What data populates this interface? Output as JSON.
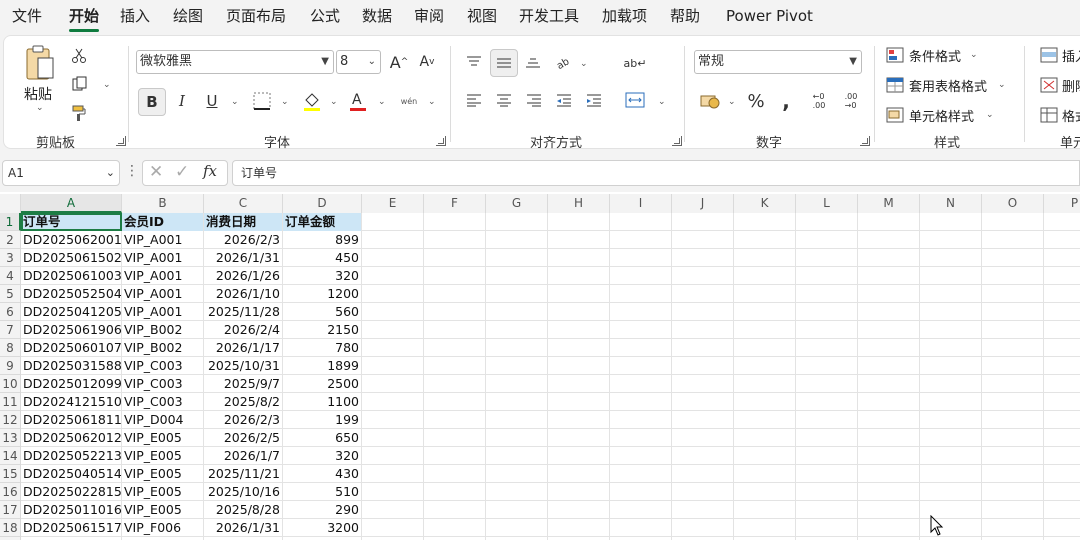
{
  "menu": {
    "tabs": [
      "文件",
      "开始",
      "插入",
      "绘图",
      "页面布局",
      "公式",
      "数据",
      "审阅",
      "视图",
      "开发工具",
      "加载项",
      "帮助",
      "Power Pivot"
    ],
    "active": "开始"
  },
  "ribbon": {
    "clipboard": {
      "paste_label": "粘贴",
      "group_label": "剪贴板"
    },
    "font": {
      "font_name": "微软雅黑",
      "font_size": "8",
      "group_label": "字体",
      "phonetic": "wén"
    },
    "alignment": {
      "group_label": "对齐方式"
    },
    "number": {
      "format": "常规",
      "group_label": "数字"
    },
    "styles": {
      "conditional": "条件格式",
      "table_format": "套用表格格式",
      "cell_style": "单元格样式",
      "group_label": "样式"
    },
    "cells": {
      "insert": "插入",
      "delete": "删除",
      "format": "格式",
      "group_label": "单元"
    }
  },
  "formula_bar": {
    "name_box": "A1",
    "fx": "fx",
    "content": "订单号"
  },
  "grid": {
    "columns": [
      "A",
      "B",
      "C",
      "D",
      "E",
      "F",
      "G",
      "H",
      "I",
      "J",
      "K",
      "L",
      "M",
      "N",
      "O",
      "P"
    ],
    "selected_cell": "A1",
    "header_row": [
      "订单号",
      "会员ID",
      "消费日期",
      "订单金额"
    ],
    "rows": [
      [
        "DD2025062001",
        "VIP_A001",
        "2026/2/3",
        "899"
      ],
      [
        "DD2025061502",
        "VIP_A001",
        "2026/1/31",
        "450"
      ],
      [
        "DD2025061003",
        "VIP_A001",
        "2026/1/26",
        "320"
      ],
      [
        "DD2025052504",
        "VIP_A001",
        "2026/1/10",
        "1200"
      ],
      [
        "DD2025041205",
        "VIP_A001",
        "2025/11/28",
        "560"
      ],
      [
        "DD2025061906",
        "VIP_B002",
        "2026/2/4",
        "2150"
      ],
      [
        "DD2025060107",
        "VIP_B002",
        "2026/1/17",
        "780"
      ],
      [
        "DD2025031588",
        "VIP_C003",
        "2025/10/31",
        "1899"
      ],
      [
        "DD2025012099",
        "VIP_C003",
        "2025/9/7",
        "2500"
      ],
      [
        "DD2024121510",
        "VIP_C003",
        "2025/8/2",
        "1100"
      ],
      [
        "DD2025061811",
        "VIP_D004",
        "2026/2/3",
        "199"
      ],
      [
        "DD2025062012",
        "VIP_E005",
        "2026/2/5",
        "650"
      ],
      [
        "DD2025052213",
        "VIP_E005",
        "2026/1/7",
        "320"
      ],
      [
        "DD2025040514",
        "VIP_E005",
        "2025/11/21",
        "430"
      ],
      [
        "DD2025022815",
        "VIP_E005",
        "2025/10/16",
        "510"
      ],
      [
        "DD2025011016",
        "VIP_E005",
        "2025/8/28",
        "290"
      ],
      [
        "DD2025061517",
        "VIP_F006",
        "2026/1/31",
        "3200"
      ]
    ]
  },
  "colors": {
    "accent": "#1d7d45",
    "header_fill": "#cde6f6"
  }
}
